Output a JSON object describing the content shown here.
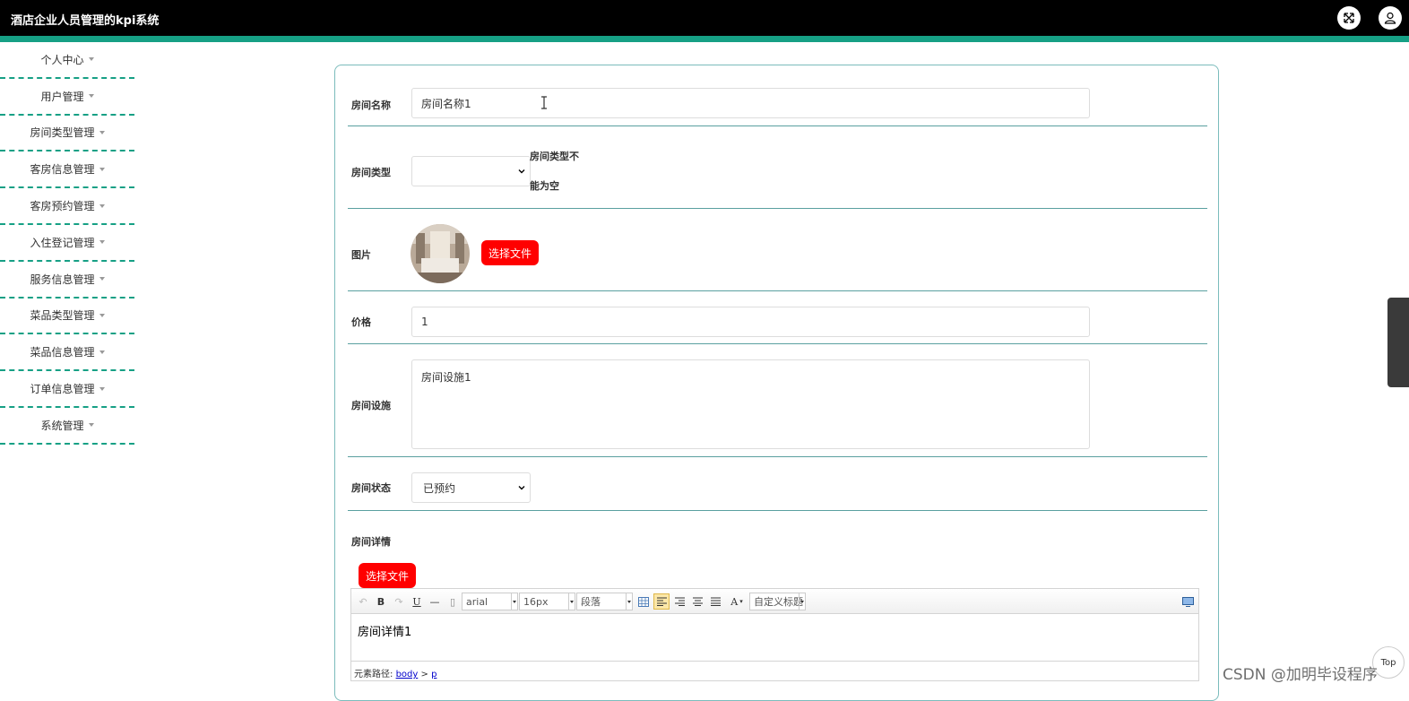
{
  "header": {
    "title": "酒店企业人员管理的kpi系统",
    "fullscreen_icon": "fullscreen-icon",
    "user_icon": "user-icon"
  },
  "colors": {
    "accent": "#16a085",
    "danger": "#ff0000",
    "header_bg": "#000000"
  },
  "sidebar": {
    "items": [
      {
        "label": "个人中心"
      },
      {
        "label": "用户管理"
      },
      {
        "label": "房间类型管理"
      },
      {
        "label": "客房信息管理"
      },
      {
        "label": "客房预约管理"
      },
      {
        "label": "入住登记管理"
      },
      {
        "label": "服务信息管理"
      },
      {
        "label": "菜品类型管理"
      },
      {
        "label": "菜品信息管理"
      },
      {
        "label": "订单信息管理"
      },
      {
        "label": "系统管理"
      }
    ]
  },
  "form": {
    "room_name": {
      "label": "房间名称",
      "value": "房间名称1"
    },
    "room_type": {
      "label": "房间类型",
      "value": "",
      "error_line1": "房间类型不",
      "error_line2": "能为空"
    },
    "image": {
      "label": "图片",
      "button": "选择文件"
    },
    "price": {
      "label": "价格",
      "value": "1"
    },
    "facilities": {
      "label": "房间设施",
      "value": "房间设施1"
    },
    "status": {
      "label": "房间状态",
      "value": "已预约"
    },
    "details": {
      "label": "房间详情",
      "button": "选择文件"
    }
  },
  "editor": {
    "font_family": "arial",
    "font_size": "16px",
    "paragraph": "段落",
    "custom_title": "自定义标题",
    "content": "房间详情1",
    "path_label": "元素路径:",
    "path_body": "body",
    "path_sep": ">",
    "path_p": "p"
  },
  "misc": {
    "top_button": "Top",
    "watermark": "CSDN @加明毕设程序"
  }
}
